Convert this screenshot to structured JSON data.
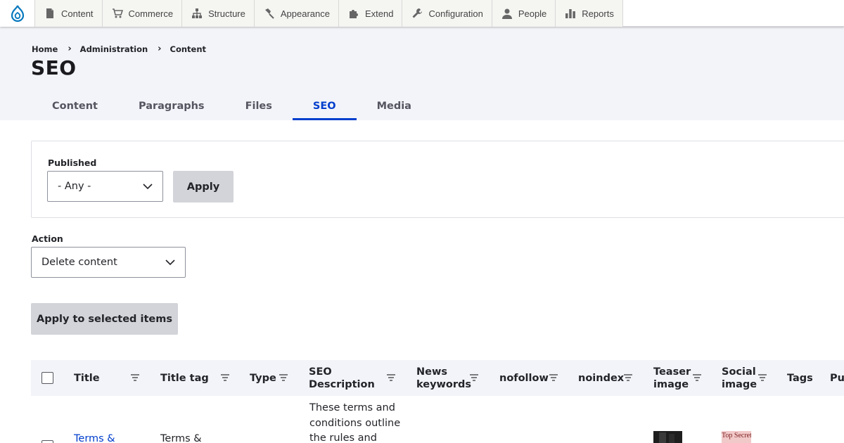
{
  "toolbar": {
    "items": [
      {
        "label": "Content",
        "icon": "document-icon"
      },
      {
        "label": "Commerce",
        "icon": "cart-icon"
      },
      {
        "label": "Structure",
        "icon": "sitemap-icon"
      },
      {
        "label": "Appearance",
        "icon": "brush-icon"
      },
      {
        "label": "Extend",
        "icon": "puzzle-icon"
      },
      {
        "label": "Configuration",
        "icon": "wrench-icon"
      },
      {
        "label": "People",
        "icon": "person-icon"
      },
      {
        "label": "Reports",
        "icon": "bar-chart-icon"
      }
    ]
  },
  "breadcrumb": [
    "Home",
    "Administration",
    "Content"
  ],
  "page_title": "SEO",
  "tabs": [
    {
      "label": "Content",
      "active": false
    },
    {
      "label": "Paragraphs",
      "active": false
    },
    {
      "label": "Files",
      "active": false
    },
    {
      "label": "SEO",
      "active": true
    },
    {
      "label": "Media",
      "active": false
    }
  ],
  "filter": {
    "published_label": "Published",
    "published_value": "- Any -",
    "apply_label": "Apply"
  },
  "bulk": {
    "action_label": "Action",
    "action_value": "Delete content",
    "apply_selected_label": "Apply to selected items"
  },
  "table": {
    "headers": [
      "Title",
      "Title tag",
      "Type",
      "SEO Description",
      "News keywords",
      "nofollow",
      "noindex",
      "Teaser image",
      "Social image",
      "Tags",
      "Pu"
    ],
    "row1": {
      "title": "Terms &",
      "title_tag": "Terms &",
      "seo_description_lines": [
        "These terms and",
        "conditions outline",
        "the rules and"
      ],
      "social_image_text": "Top Secret"
    }
  },
  "colors": {
    "accent": "#003ecc",
    "header_bg": "#f3f4f9",
    "button_bg": "#d3d4d9",
    "drupal_blue": "#0678be"
  }
}
